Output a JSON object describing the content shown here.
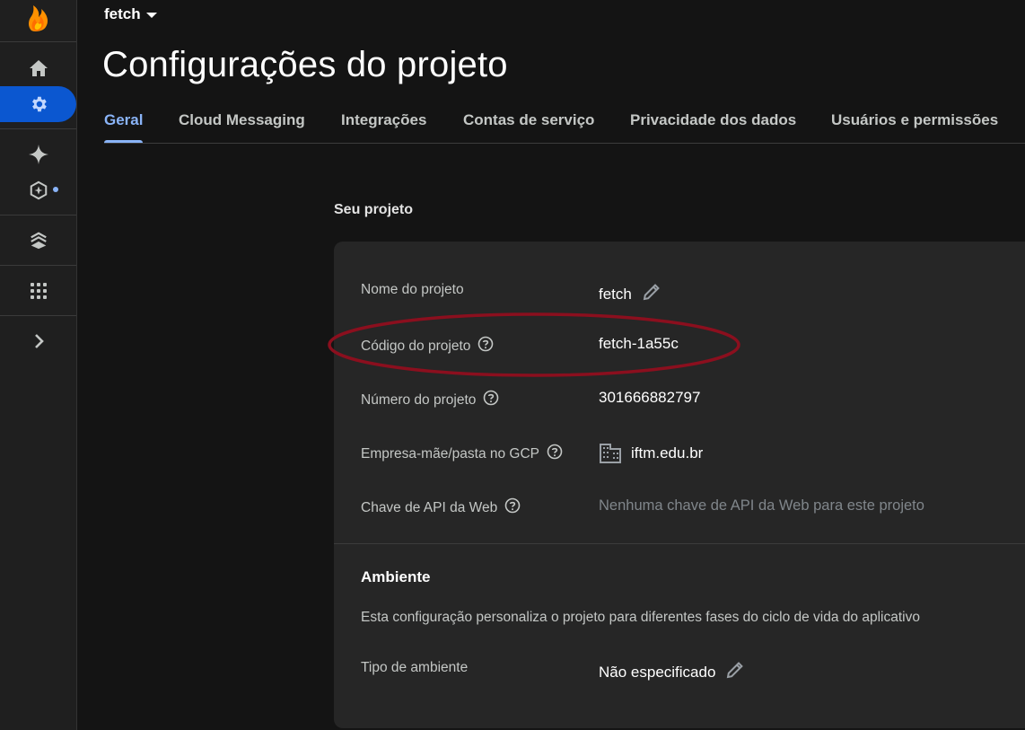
{
  "header": {
    "project_name": "fetch",
    "page_title": "Configurações do projeto"
  },
  "tabs": [
    {
      "label": "Geral",
      "active": true
    },
    {
      "label": "Cloud Messaging",
      "active": false
    },
    {
      "label": "Integrações",
      "active": false
    },
    {
      "label": "Contas de serviço",
      "active": false
    },
    {
      "label": "Privacidade dos dados",
      "active": false
    },
    {
      "label": "Usuários e permissões",
      "active": false
    }
  ],
  "rail": {
    "items": [
      "firebase-logo",
      "home-icon",
      "settings-icon",
      "sparkle-icon",
      "extensions-icon",
      "layers-icon",
      "grid-icon",
      "chevron-right-icon"
    ],
    "active": "settings-icon",
    "accent": "#0b57d0"
  },
  "project_section": {
    "title": "Seu projeto",
    "rows": [
      {
        "label": "Nome do projeto",
        "value": "fetch"
      },
      {
        "label": "Código do projeto",
        "value": "fetch-1a55c"
      },
      {
        "label": "Número do projeto",
        "value": "301666882797"
      },
      {
        "label": "Empresa-mãe/pasta no GCP",
        "value": "iftm.edu.br"
      },
      {
        "label": "Chave de API da Web",
        "value": "Nenhuma chave de API da Web para este projeto"
      }
    ]
  },
  "environment": {
    "title": "Ambiente",
    "description": "Esta configuração personaliza o projeto para diferentes fases do ciclo de vida do aplicativo",
    "type_label": "Tipo de ambiente",
    "type_value": "Não especificado"
  },
  "colors": {
    "active_tab": "#8ab4f8",
    "annotation": "#8b0f1e"
  }
}
